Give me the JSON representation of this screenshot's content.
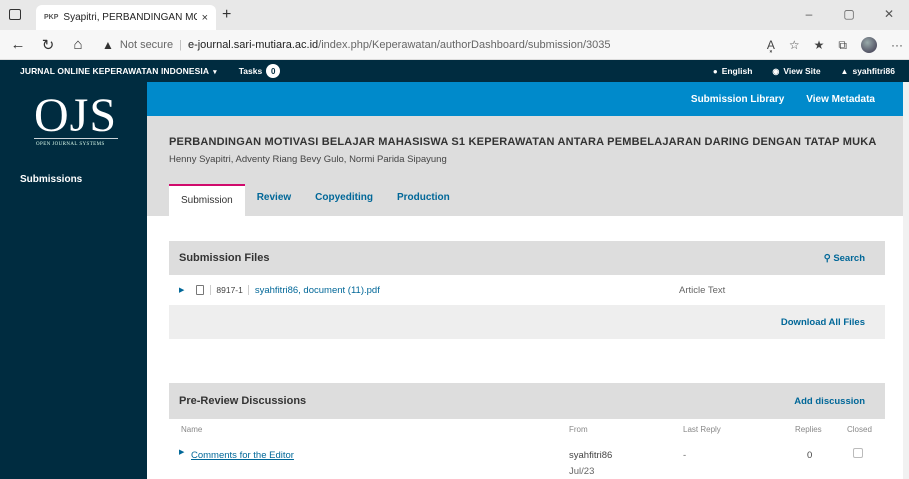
{
  "browser": {
    "tab_favicon": "PKP",
    "tab_title": "Syapitri, PERBANDINGAN MOTIV",
    "tab_close": "×",
    "new_tab": "+",
    "win_minimize": "–",
    "win_restore": "▢",
    "win_close": "✕",
    "nav_back": "←",
    "nav_reload": "↻",
    "nav_home": "⌂",
    "security_icon": "▲",
    "security_label": "Not secure",
    "url_sep": "|",
    "url_domain": "e-journal.sari-mutiara.ac.id",
    "url_path": "/index.php/Keperawatan/authorDashboard/submission/3035",
    "icon_read_aloud": "A͓",
    "icon_favorite_add": "☆",
    "icon_favorites": "★",
    "icon_collections": "⧉",
    "icon_more": "···"
  },
  "topnav": {
    "journal_name": "JURNAL ONLINE KEPERAWATAN INDONESIA",
    "caret": "▾",
    "tasks_label": "Tasks",
    "tasks_count": "0",
    "language": "English",
    "language_icon": "●",
    "view_site": "View Site",
    "view_site_icon": "◉",
    "user": "syahfitri86",
    "user_icon": "▲"
  },
  "sidebar": {
    "logo_text": "OJS",
    "logo_sub": "OPEN JOURNAL SYSTEMS",
    "items": [
      {
        "label": "Submissions"
      }
    ]
  },
  "contextbar": {
    "submission_library": "Submission Library",
    "view_metadata": "View Metadata"
  },
  "submission": {
    "title": "PERBANDINGAN MOTIVASI BELAJAR MAHASISWA S1 KEPERAWATAN ANTARA PEMBELAJARAN DARING DENGAN TATAP MUKA",
    "authors": "Henny Syapitri, Adventy Riang Bevy Gulo, Normi Parida Sipayung",
    "tabs": [
      {
        "label": "Submission"
      },
      {
        "label": "Review"
      },
      {
        "label": "Copyediting"
      },
      {
        "label": "Production"
      }
    ]
  },
  "files_panel": {
    "title": "Submission Files",
    "search_label": "Search",
    "search_icon": "⚲",
    "expand_icon": "▶",
    "file": {
      "id": "8917-1",
      "name": "syahfitri86, document (11).pdf",
      "type": "Article Text"
    },
    "download_all": "Download All Files"
  },
  "discussions_panel": {
    "title": "Pre-Review Discussions",
    "add_label": "Add discussion",
    "columns": {
      "name": "Name",
      "from": "From",
      "last_reply": "Last Reply",
      "replies": "Replies",
      "closed": "Closed"
    },
    "expand_icon": "▶",
    "rows": [
      {
        "name": "Comments for the Editor",
        "from_user": "syahfitri86",
        "from_date": "Jul/23",
        "last_reply": "-",
        "replies": "0"
      }
    ]
  }
}
